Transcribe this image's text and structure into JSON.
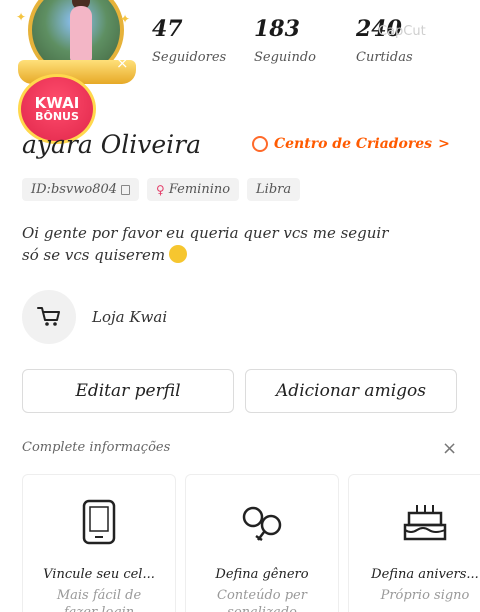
{
  "profile": {
    "name": "ayara Oliveira",
    "creator_center": "Centro de Criadores",
    "creator_chevron": ">",
    "id_tag": "ID:bsvwo804",
    "gender_tag": "Feminino",
    "sign_tag": "Libra",
    "bio": "Oi gente por favor eu queria quer vcs me seguir\nsó se vcs quiserem"
  },
  "avatar": {
    "close": "×"
  },
  "badge": {
    "line1": "KWAI",
    "line2": "BÔNUS"
  },
  "stats": [
    {
      "value": "47",
      "label": "Seguidores"
    },
    {
      "value": "183",
      "label": "Seguindo"
    },
    {
      "value": "240",
      "label": "Curtidas"
    }
  ],
  "watermark": "CapCut",
  "shop": {
    "label": "Loja Kwai",
    "icon": "cart-icon"
  },
  "buttons": {
    "edit": "Editar perfil",
    "add_friends": "Adicionar amigos"
  },
  "complete": {
    "title": "Complete informações",
    "close": "×",
    "cards": [
      {
        "icon": "phone-icon",
        "title": "Vincule seu cel...",
        "sub": "Mais fácil de\nfazer login"
      },
      {
        "icon": "gender-icon",
        "title": "Defina gênero",
        "sub": "Conteúdo per\nsonalizado"
      },
      {
        "icon": "cake-icon",
        "title": "Defina anivers...",
        "sub": "Próprio signo"
      }
    ]
  }
}
